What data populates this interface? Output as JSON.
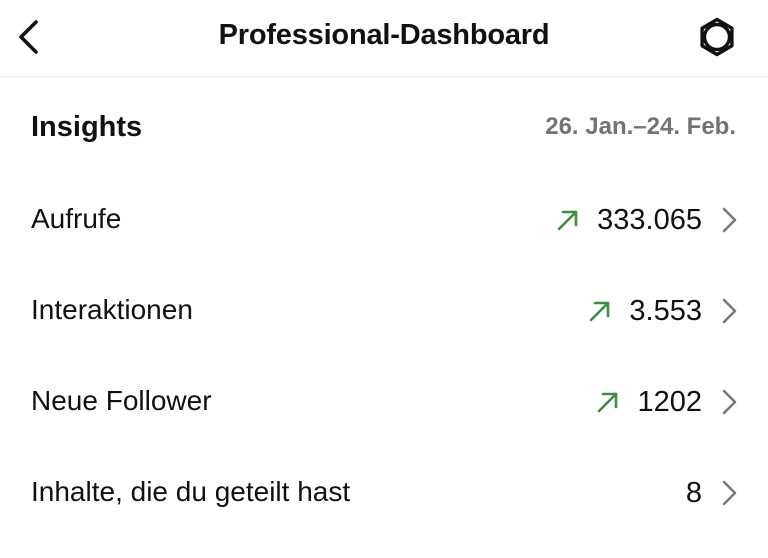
{
  "header": {
    "title": "Professional-Dashboard",
    "back_icon": "chevron-left-icon",
    "settings_icon": "gear-icon"
  },
  "insights": {
    "title": "Insights",
    "date_range": "26. Jan.–24. Feb."
  },
  "stats": [
    {
      "label": "Aufrufe",
      "value": "333.065",
      "trend": "up"
    },
    {
      "label": "Interaktionen",
      "value": "3.553",
      "trend": "up"
    },
    {
      "label": "Neue Follower",
      "value": "1202",
      "trend": "up"
    },
    {
      "label": "Inhalte, die du geteilt hast",
      "value": "8",
      "trend": "none"
    }
  ],
  "colors": {
    "trend_up": "#3a8f3f",
    "secondary_text": "#737373",
    "chevron": "#7a7a7a"
  }
}
